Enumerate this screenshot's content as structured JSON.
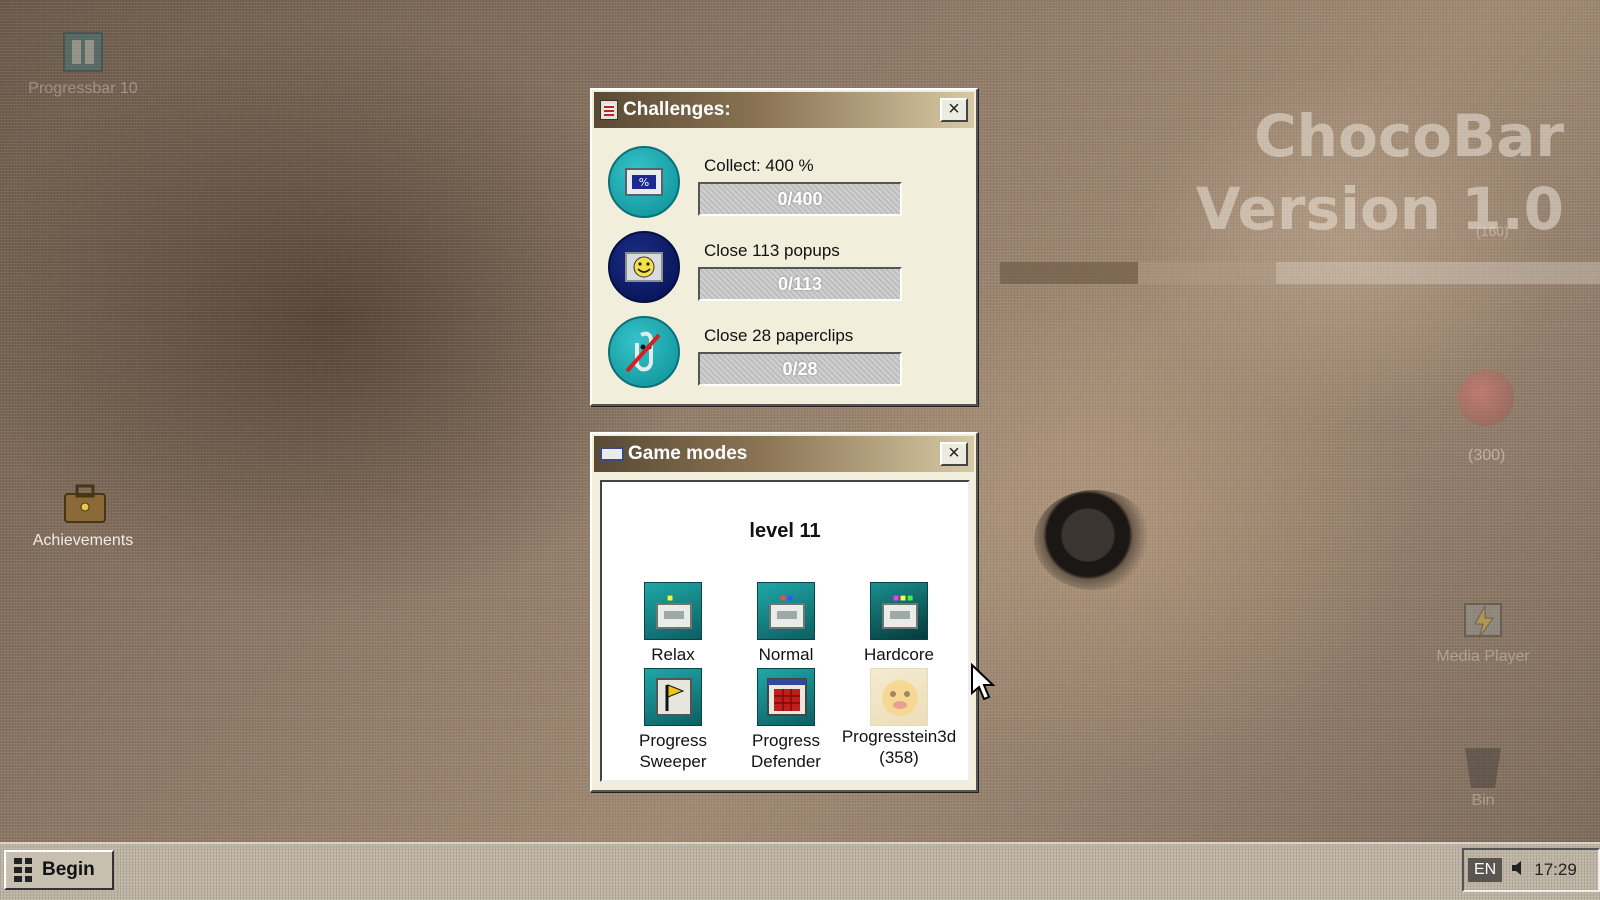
{
  "desktop": {
    "title_line1": "ChocoBar",
    "title_line2": "Version 1.0",
    "title_sub": "(160)",
    "faded_counter": "(300)",
    "icons": [
      {
        "label": "Progressbar 10",
        "icon": "progressbar-icon"
      },
      {
        "label": "Achievements",
        "icon": "briefcase-icon"
      },
      {
        "label": "Media Player",
        "icon": "media-player-icon"
      },
      {
        "label": "Bin",
        "icon": "bin-icon"
      }
    ]
  },
  "challenges_window": {
    "title": "Challenges:",
    "close_label": "×",
    "items": [
      {
        "label": "Collect: 400 %",
        "progress_text": "0/400",
        "progress_value": 0,
        "icon": "percent-segment-icon",
        "color": "#0b8f95"
      },
      {
        "label": "Close 113 popups",
        "progress_text": "0/113",
        "progress_value": 0,
        "icon": "smiley-popup-icon",
        "color": "#050f4d"
      },
      {
        "label": "Close 28 paperclips",
        "progress_text": "0/28",
        "progress_value": 0,
        "icon": "no-paperclip-icon",
        "color": "#0b8f95"
      }
    ]
  },
  "game_modes_window": {
    "title": "Game modes",
    "close_label": "×",
    "level": "level 11",
    "modes": [
      {
        "line1": "Relax",
        "line2": "",
        "icon": "relax-mode-icon"
      },
      {
        "line1": "Normal",
        "line2": "",
        "icon": "normal-mode-icon"
      },
      {
        "line1": "Hardcore",
        "line2": "",
        "icon": "hardcore-mode-icon"
      },
      {
        "line1": "Progress",
        "line2": "Sweeper",
        "icon": "flag-icon"
      },
      {
        "line1": "Progress",
        "line2": "Defender",
        "icon": "defender-icon"
      },
      {
        "line1": "Progresstein3d",
        "line2": "(358)",
        "icon": "dog-face-icon"
      }
    ]
  },
  "taskbar": {
    "start_label": "Begin",
    "language": "EN",
    "clock": "17:29"
  }
}
